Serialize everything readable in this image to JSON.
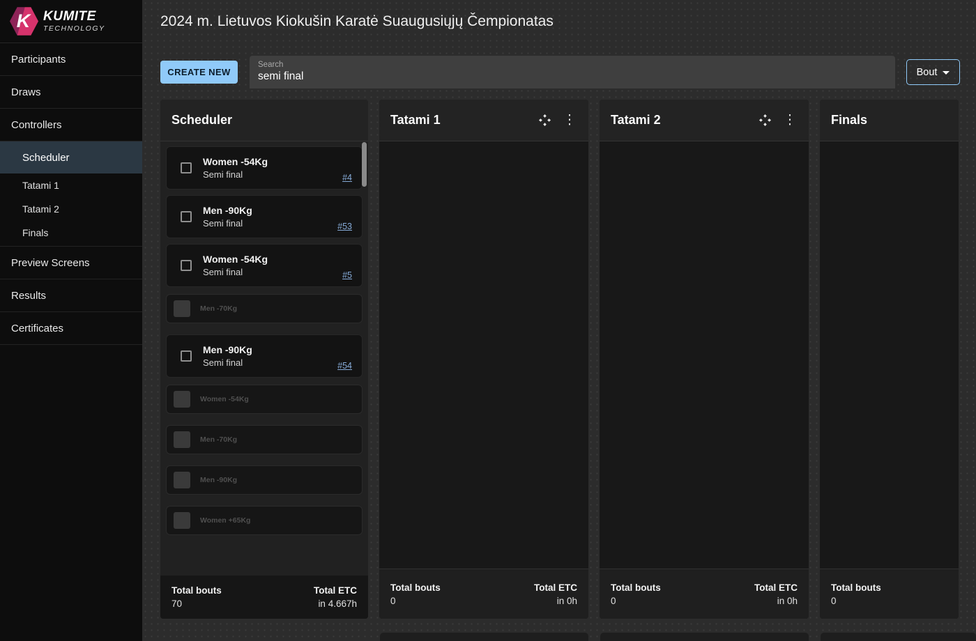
{
  "brand": {
    "name": "KUMITE",
    "tagline": "TECHNOLOGY",
    "logo_letter": "K",
    "logo_colors": [
      "#8e2458",
      "#d6336c"
    ]
  },
  "header": {
    "title": "2024 m. Lietuvos Kiokušin Karatė Suaugusiųjų Čempionatas"
  },
  "sidebar": {
    "top_items": [
      {
        "label": "Participants"
      },
      {
        "label": "Draws"
      },
      {
        "label": "Controllers"
      }
    ],
    "controller_subitems": [
      {
        "label": "Scheduler",
        "active": true
      },
      {
        "label": "Tatami 1"
      },
      {
        "label": "Tatami 2"
      },
      {
        "label": "Finals"
      }
    ],
    "bottom_items": [
      {
        "label": "Preview Screens"
      },
      {
        "label": "Results"
      },
      {
        "label": "Certificates"
      }
    ]
  },
  "toolbar": {
    "create_label": "CREATE NEW",
    "search": {
      "label": "Search",
      "value": "semi final"
    },
    "bout_label": "Bout"
  },
  "icons": {
    "kebab": "⋮"
  },
  "colors": {
    "accent": "#90caf9",
    "link": "#86abd8",
    "active_nav": "#2b3843"
  },
  "scheduler": {
    "title": "Scheduler",
    "cards": [
      {
        "title": "Women -54Kg",
        "subtitle": "Semi final",
        "bout": "#4"
      },
      {
        "title": "Men -90Kg",
        "subtitle": "Semi final",
        "bout": "#53"
      },
      {
        "title": "Women -54Kg",
        "subtitle": "Semi final",
        "bout": "#5"
      },
      {
        "title": "Men -70Kg",
        "state": "disabled"
      },
      {
        "title": "Men -90Kg",
        "subtitle": "Semi final",
        "bout": "#54"
      },
      {
        "title": "Women -54Kg",
        "state": "disabled"
      },
      {
        "title": "Men -70Kg",
        "state": "disabled"
      },
      {
        "title": "Men -90Kg",
        "state": "disabled"
      },
      {
        "title": "Women +65Kg",
        "state": "disabled"
      }
    ],
    "footer": {
      "bouts_label": "Total bouts",
      "bouts_value": "70",
      "etc_label": "Total ETC",
      "etc_value": "in 4.667h"
    }
  },
  "columns": [
    {
      "title": "Tatami 1",
      "icons": true,
      "footer": {
        "bouts_label": "Total bouts",
        "bouts_value": "0",
        "etc_label": "Total ETC",
        "etc_value": "in 0h"
      }
    },
    {
      "title": "Tatami 2",
      "icons": true,
      "footer": {
        "bouts_label": "Total bouts",
        "bouts_value": "0",
        "etc_label": "Total ETC",
        "etc_value": "in 0h"
      }
    },
    {
      "title": "Finals",
      "icons": false,
      "narrow": true,
      "footer": {
        "bouts_label": "Total bouts",
        "bouts_value": "0"
      }
    }
  ]
}
